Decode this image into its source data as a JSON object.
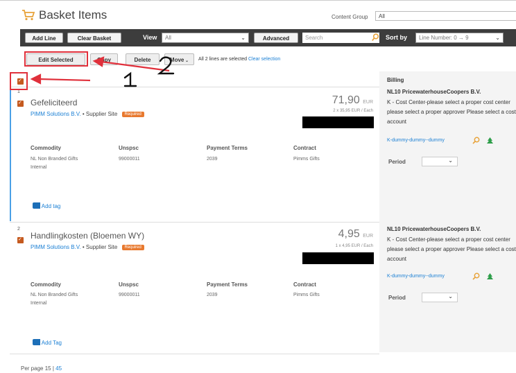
{
  "header": {
    "title": "Basket Items",
    "content_group_label": "Content Group",
    "content_group_value": "All"
  },
  "toolbar": {
    "add_line": "Add Line",
    "clear_basket": "Clear Basket",
    "view_label": "View",
    "view_value": "All",
    "advanced": "Advanced",
    "search_placeholder": "Search",
    "sort_label": "Sort by",
    "sort_value": "Line Number: 0 → 9"
  },
  "actions": {
    "edit_selected": "Edit Selected",
    "copy": "Copy",
    "delete": "Delete",
    "move": "Move",
    "selection_text": "All 2 lines are selected",
    "clear_selection": "Clear selection"
  },
  "annotations": {
    "one": "1",
    "two": "2"
  },
  "billing": {
    "title": "Billing"
  },
  "columns": {
    "commodity": "Commodity",
    "unspsc": "Unspsc",
    "payment_terms": "Payment Terms",
    "contract": "Contract"
  },
  "items": [
    {
      "line": "1",
      "name": "Gefeliciteerd",
      "supplier": "PIMM Solutions B.V.",
      "supplier_site": "Supplier Site",
      "required": "Required",
      "price": "71,90",
      "currency": "EUR",
      "unit_price": "2 x 35,95 EUR / Each",
      "commodity_line1": "NL Non Branded Gifts",
      "commodity_line2": "Internal",
      "unspsc": "99000011",
      "payment_terms": "2039",
      "contract": "Pimms Gifts",
      "add_tag": "Add tag",
      "billing_org": "NL10 PricewaterhouseCoopers B.V.",
      "billing_text": "K - Cost Center-please select a proper cost center please select a proper approver Please select a cost account",
      "billing_link": "K-dummy-dummy--dummy",
      "period_label": "Period"
    },
    {
      "line": "2",
      "name": "Handlingkosten (Bloemen WY)",
      "supplier": "PIMM Solutions B.V.",
      "supplier_site": "Supplier Site",
      "required": "Required",
      "price": "4,95",
      "currency": "EUR",
      "unit_price": "1 x 4,95 EUR / Each",
      "commodity_line1": "NL Non Branded Gifts",
      "commodity_line2": "Internal",
      "unspsc": "99000011",
      "payment_terms": "2039",
      "contract": "Pimms Gifts",
      "add_tag": "Add Tag",
      "billing_org": "NL10 PricewaterhouseCoopers B.V.",
      "billing_text": "K - Cost Center-please select a proper cost center please select a proper approver Please select a cost account",
      "billing_link": "K-dummy-dummy--dummy",
      "period_label": "Period"
    }
  ],
  "footer": {
    "per_page_label": "Per page",
    "opt1": "15",
    "divider": "|",
    "opt2": "45"
  },
  "colors": {
    "accent": "#1a7fd4",
    "checkbox": "#c55a1f",
    "annotation": "#e0303b",
    "toolbar": "#3d3d3d"
  }
}
